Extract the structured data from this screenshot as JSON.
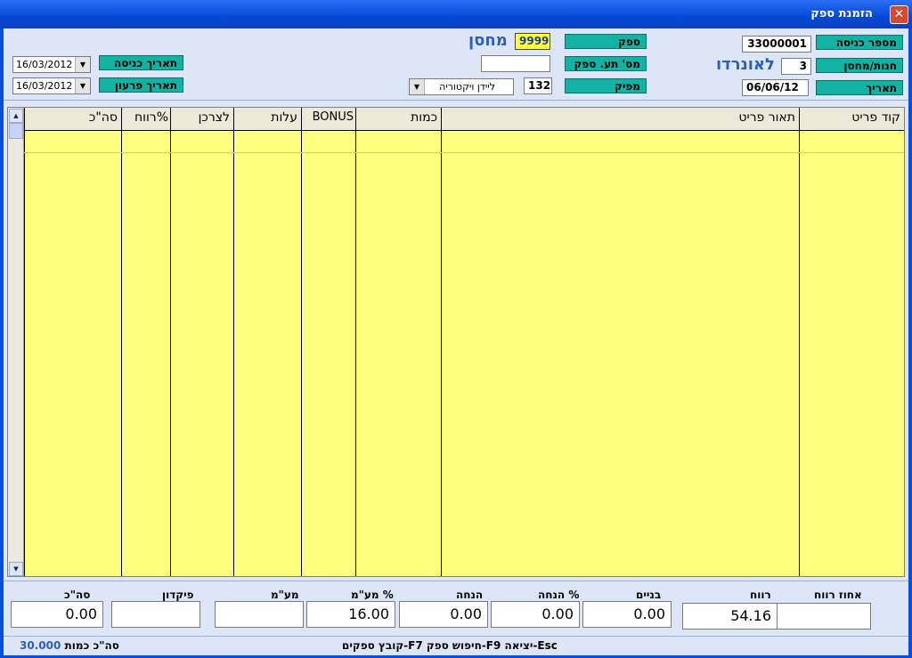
{
  "window": {
    "title": "הזמנת ספק",
    "close_glyph": "✕"
  },
  "header": {
    "entry_number_label": "מספר כניסה",
    "entry_number_value": "33000001",
    "store_label": "חנות/מחסן",
    "store_value": "3",
    "store_name": "לאונרדו",
    "date_label": "תאריך",
    "date_value": "06/06/12",
    "supplier_label": "ספק",
    "supplier_value": "9999",
    "warehouse_title": "מחסן",
    "supplier_cert_label": "מס' תע. ספק",
    "supplier_cert_value": "",
    "distributor_label": "מפיק",
    "distributor_code": "132",
    "distributor_name": "ליידן ויקטוריה",
    "entry_date_label": "תאריך כניסה",
    "entry_date_value": "16/03/2012",
    "payment_date_label": "תאריך פרעון",
    "payment_date_value": "16/03/2012"
  },
  "grid": {
    "columns": [
      "קוד פריט",
      "תאור פריט",
      "כמות",
      "BONUS",
      "עלות",
      "לצרכן",
      "%רווח",
      "סה\"כ"
    ]
  },
  "footer": {
    "profit_pct_label": "אחוז רווח",
    "profit_pct_value": "",
    "profit_label": "רווח",
    "profit_value": "54.16",
    "gross_label": "בניים",
    "gross_value": "0.00",
    "discount_pct_label": "% הנחה",
    "discount_pct_value": "0.00",
    "discount_label": "הנחה",
    "discount_value": "0.00",
    "vat_pct_label": "% מע\"מ",
    "vat_pct_value": "16.00",
    "vat_label": "מע\"מ",
    "vat_value": "",
    "deposit_label": "פיקדון",
    "deposit_value": "",
    "total_label": "סה\"כ",
    "total_value": "0.00"
  },
  "status": {
    "hint": "Esc-יציאה F9-חיפוש ספק F7-קובץ ספקים",
    "total_qty_label": "סה\"כ כמות",
    "total_qty_value": "30.000"
  },
  "colors": {
    "teal": "#13b3a4",
    "grid_yellow": "#ffff80",
    "title_blue": "#0a4ee0",
    "accent_blue": "#2e5fb5"
  }
}
